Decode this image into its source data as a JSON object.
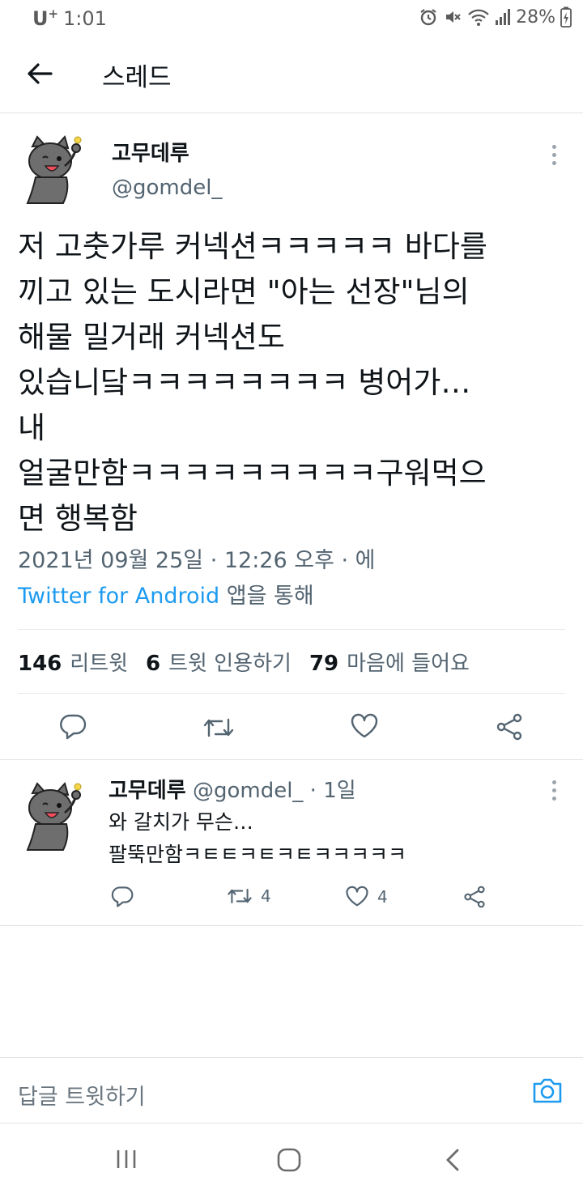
{
  "status_bar": {
    "carrier": "U",
    "carrier_sup": "+",
    "time": "1:01",
    "battery": "28%"
  },
  "header": {
    "title": "스레드",
    "back_icon": "arrow-left-icon"
  },
  "main_tweet": {
    "author_name": "고무데루",
    "author_handle": "@gomdel_",
    "text_lines": [
      "저 고춧가루 커넥션ㅋㅋㅋㅋㅋ 바다를",
      "끼고 있는 도시라면 \"아는 선장\"님의",
      "해물 밀거래 커넥션도",
      "있습니닼ㅋㅋㅋㅋㅋㅋㅋㅋ 병어가…",
      "내",
      "얼굴만함ㅋㅋㅋㅋㅋㅋㅋㅋㅋ구워먹으",
      "면 행복함"
    ],
    "timestamp": "2021년 09월 25일 · 12:26 오후 · 에",
    "source": "Twitter for Android",
    "source_suffix": " 앱을 통해",
    "stats": {
      "retweets_num": "146",
      "retweets_label": "리트윗",
      "quotes_num": "6",
      "quotes_label": "트윗 인용하기",
      "likes_num": "79",
      "likes_label": "마음에 들어요"
    }
  },
  "reply": {
    "author_name": "고무데루",
    "meta": " @gomdel_ · 1일",
    "text_lines": [
      "와 갈치가 무슨…",
      "팔뚝만함ㅋㅌㅌㅋㅌㅋㅌㅋㅋㅋㅋㅋ"
    ],
    "retweet_count": "4",
    "like_count": "4"
  },
  "compose": {
    "placeholder": "답글 트윗하기"
  },
  "colors": {
    "link": "#1d9bf0",
    "secondary_text": "#536471",
    "divider": "#e1e4e6"
  }
}
